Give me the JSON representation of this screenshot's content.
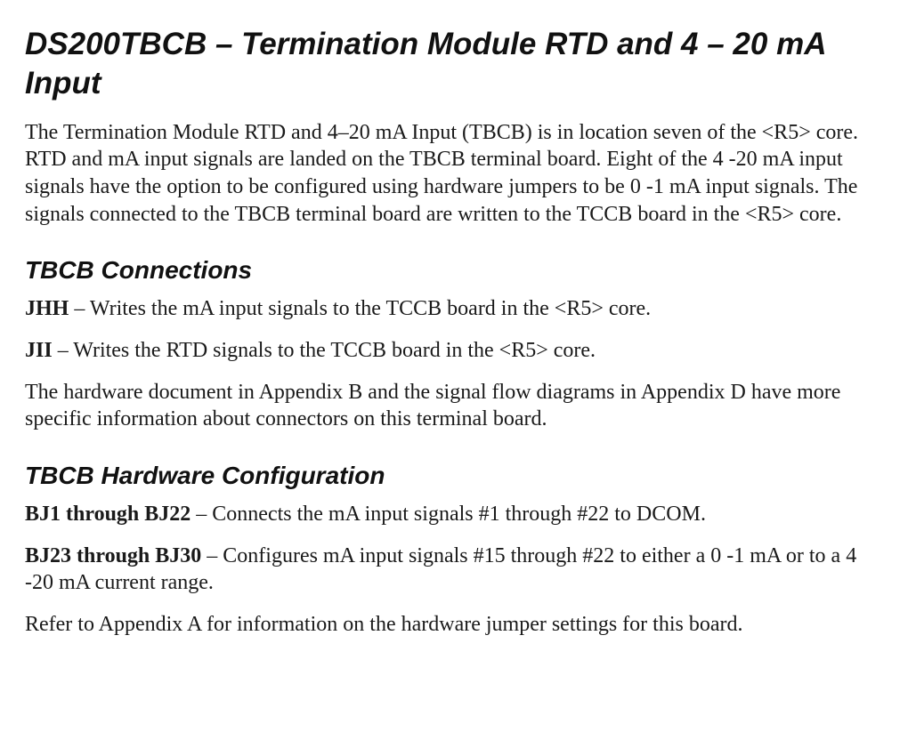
{
  "title": "DS200TBCB – Termination Module RTD and 4 – 20 mA Input",
  "intro": "The Termination Module RTD and 4–20 mA Input (TBCB) is in location seven of the <R5> core. RTD and mA input signals are landed on the TBCB terminal board. Eight of the 4 -20 mA input signals have the option to be configured using hardware jumpers to be 0 -1 mA input signals. The signals connected to the TBCB terminal board are written to the TCCB board in the <R5> core.",
  "sections": {
    "connections": {
      "heading": "TBCB Connections",
      "items": [
        {
          "lead": "JHH",
          "rest": " – Writes the mA input signals to the TCCB board in the <R5> core."
        },
        {
          "lead": "JII",
          "rest": " – Writes the RTD signals to the TCCB board in the <R5> core."
        }
      ],
      "note": "The hardware document in Appendix B and the signal flow diagrams in Appendix D have more specific information about connectors on this terminal board."
    },
    "hwconfig": {
      "heading": "TBCB Hardware Configuration",
      "items": [
        {
          "lead": "BJ1 through BJ22",
          "rest": " – Connects the mA input signals #1 through #22 to  DCOM."
        },
        {
          "lead": "BJ23 through BJ30",
          "rest": " – Configures mA input signals #15 through #22 to either a 0 -1 mA or to a 4 -20 mA current range."
        }
      ],
      "note": "Refer to Appendix A for information on the hardware jumper settings for this board."
    }
  }
}
